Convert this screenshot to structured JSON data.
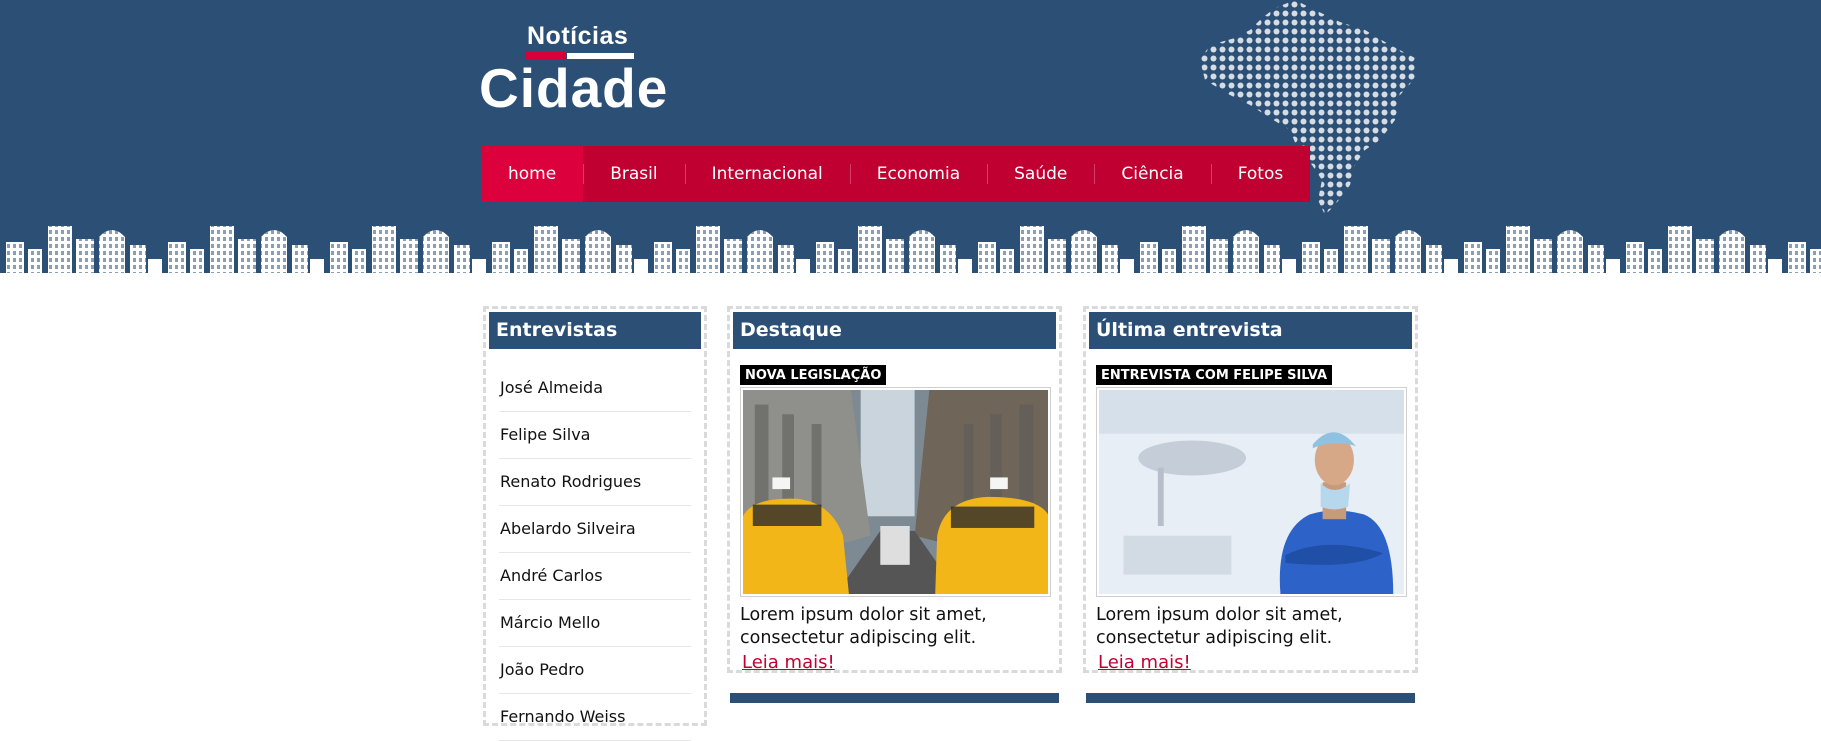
{
  "logo": {
    "top": "Notícias",
    "main": "Cidade"
  },
  "nav": {
    "items": [
      "home",
      "Brasil",
      "Internacional",
      "Economia",
      "Saúde",
      "Ciência",
      "Fotos"
    ]
  },
  "sidebar": {
    "title": "Entrevistas",
    "items": [
      "José Almeida",
      "Felipe Silva",
      "Renato Rodrigues",
      "Abelardo Silveira",
      "André Carlos",
      "Márcio Mello",
      "João Pedro",
      "Fernando Weiss"
    ]
  },
  "featured": {
    "title": "Destaque",
    "tag": "NOVA LEGISLAÇÃO",
    "text": "Lorem ipsum dolor sit amet, consectetur adipiscing elit.",
    "link": "Leia mais!"
  },
  "latest": {
    "title": "Última entrevista",
    "tag": "ENTREVISTA COM FELIPE SILVA",
    "text": "Lorem ipsum dolor sit amet, consectetur adipiscing elit.",
    "link": "Leia mais!"
  },
  "colors": {
    "navy": "#2b4f75",
    "red": "#c10032",
    "active_red": "#dc003d"
  }
}
